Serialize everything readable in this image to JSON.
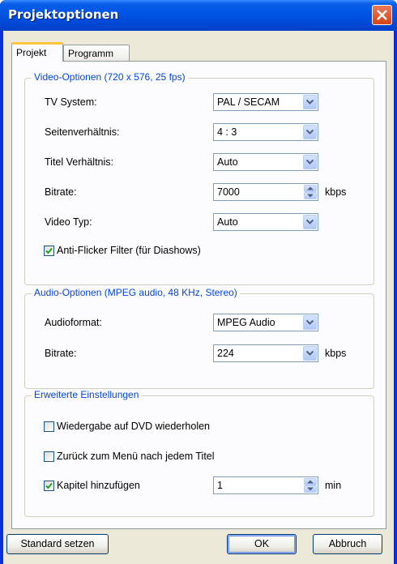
{
  "window": {
    "title": "Projektoptionen"
  },
  "tabs": [
    {
      "label": "Projekt",
      "active": true
    },
    {
      "label": "Programm",
      "active": false
    }
  ],
  "video": {
    "legend": "Video-Optionen (720 x 576, 25 fps)",
    "tv_system": {
      "label": "TV System:",
      "value": "PAL / SECAM"
    },
    "aspect": {
      "label": "Seitenverhältnis:",
      "value": "4 : 3"
    },
    "title_ratio": {
      "label": "Titel Verhältnis:",
      "value": "Auto"
    },
    "bitrate": {
      "label": "Bitrate:",
      "value": "7000",
      "unit": "kbps"
    },
    "video_type": {
      "label": "Video Typ:",
      "value": "Auto"
    },
    "anti_flicker": {
      "label": "Anti-Flicker Filter (für Diashows)",
      "checked": true
    }
  },
  "audio": {
    "legend": "Audio-Optionen (MPEG audio, 48 KHz, Stereo)",
    "format": {
      "label": "Audioformat:",
      "value": "MPEG Audio"
    },
    "bitrate": {
      "label": "Bitrate:",
      "value": "224",
      "unit": "kbps"
    }
  },
  "advanced": {
    "legend": "Erweiterte Einstellungen",
    "repeat_dvd": {
      "label": "Wiedergabe auf DVD wiederholen",
      "checked": false
    },
    "back_to_menu": {
      "label": "Zurück zum Menü nach jedem Titel",
      "checked": false
    },
    "add_chapters": {
      "label": "Kapitel hinzufügen",
      "checked": true,
      "value": "1",
      "unit": "min"
    }
  },
  "buttons": {
    "defaults": "Standard setzen",
    "ok": "OK",
    "cancel": "Abbruch"
  },
  "colors": {
    "titlebar": "#0055e5",
    "close": "#d64316",
    "legend": "#0046d5",
    "face": "#ece9d8"
  }
}
